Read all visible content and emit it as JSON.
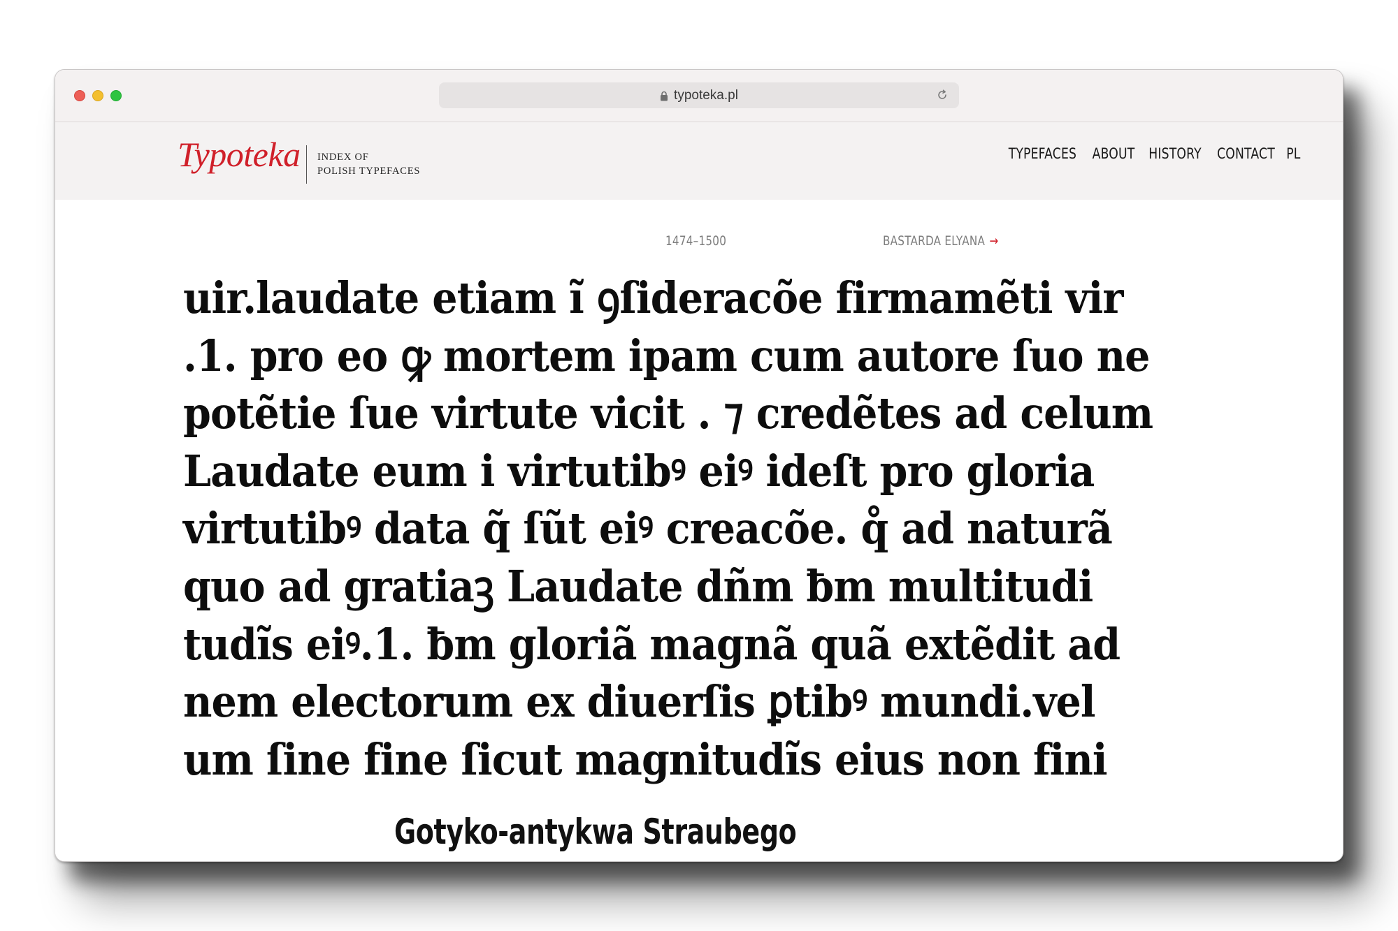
{
  "browser": {
    "url": "typoteka.pl"
  },
  "header": {
    "logo": "Typoteka",
    "tagline_line1": "INDEX OF",
    "tagline_line2": "POLISH TYPEFACES",
    "nav": [
      {
        "label": "TYPEFACES"
      },
      {
        "label": "ABOUT"
      },
      {
        "label": "HISTORY"
      },
      {
        "label": "CONTACT"
      },
      {
        "label": "PL"
      }
    ]
  },
  "specimen": {
    "date_range": "1474–1500",
    "next_typeface": "BASTARDA ELYANA",
    "next_arrow": "→",
    "lines": [
      "uir.laudate etiam ĩ ꝯſideracõe firmamẽti vir",
      ".1. pro eo ꝙ mortem ipam cum autore ſuo ne",
      "potẽtie ſue virtute vicit . ⁊ credẽtes ad celum",
      "Laudate eum i virtutibꝰ eiꝰ ideſt pro gloria",
      "virtutibꝰ data q̃ ſũt eiꝰ creacõe. q̊ ad naturã",
      "quo ad gratiaꝫ Laudate dñm ƀm multitudi",
      "tudĩs eiꝰ.1. ƀm gloriã magnã quã extẽdit ad",
      "nem electorum ex diuerſis ꝑtibꝰ mundi.vel",
      "um ſine fine ſicut magnitudĩs eius non fini"
    ],
    "typeface_name": "Gotyko-antykwa Straubego"
  },
  "colors": {
    "accent": "#d0202a",
    "header_bg": "#f4f2f2",
    "muted_text": "#7d7d7d"
  }
}
